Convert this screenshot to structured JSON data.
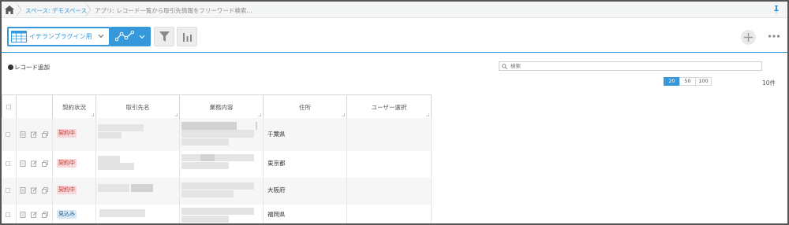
{
  "breadcrumb": {
    "space": "スペース: デモスペース",
    "app": "アプリ: レコード一覧から取引先情報をフリーワード検索..."
  },
  "toolbar": {
    "view_label": "イテランプラグイン用"
  },
  "records": {
    "add_label": "レコード追加",
    "search_placeholder": "検索",
    "page_sizes": [
      "20",
      "50",
      "100"
    ],
    "count": "10件"
  },
  "table": {
    "headers": [
      "契約状況",
      "取引先名",
      "業務内容",
      "住所",
      "ユーザー選択"
    ],
    "rows": [
      {
        "status": "契約中",
        "status_color": "#f9d7d9",
        "address": "千葉県"
      },
      {
        "status": "契約中",
        "status_color": "#f9d7d9",
        "address": "東京都"
      },
      {
        "status": "契約中",
        "status_color": "#f9d7d9",
        "address": "大阪府"
      },
      {
        "status": "見込み",
        "status_color": "#d7e8f6",
        "address": "福岡県"
      }
    ]
  },
  "colors": {
    "accent": "#3498db"
  },
  "icons": [
    "home-icon",
    "pin-icon",
    "table-view-icon",
    "chevron-down-icon",
    "line-graph-icon",
    "filter-icon",
    "bar-chart-icon",
    "plus-icon",
    "more-icon",
    "search-icon",
    "detail-icon",
    "edit-icon",
    "copy-icon"
  ]
}
